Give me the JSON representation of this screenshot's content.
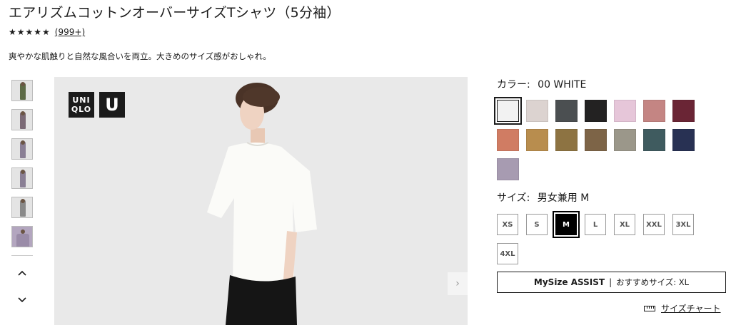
{
  "product": {
    "title": "エアリズムコットンオーバーサイズTシャツ（5分袖）",
    "stars": "★★★★★",
    "review_count": "(999+)",
    "description": "爽やかな肌触りと自然な風合いを両立。大きめのサイズ感がおしゃれ。"
  },
  "gallery": {
    "logo_text": "UNI QLO",
    "logo_u": "U",
    "prev_arrow": "^",
    "next_arrow": "v",
    "image_next": "›"
  },
  "color": {
    "label": "カラー:",
    "selected_name": "00 WHITE",
    "swatches": [
      "#f2f2f2",
      "#dcd3d0",
      "#4b4f51",
      "#232222",
      "#e6c6d9",
      "#c48583",
      "#6a2535",
      "#d07c63",
      "#b88d4e",
      "#8d7342",
      "#7d6447",
      "#9b978a",
      "#3f5b5f",
      "#283153",
      "#a79bb1"
    ]
  },
  "size": {
    "label": "サイズ:",
    "selected_name": "男女兼用 M",
    "options": [
      "XS",
      "S",
      "M",
      "L",
      "XL",
      "XXL",
      "3XL",
      "4XL"
    ]
  },
  "mysize": {
    "title": "MySize ASSIST",
    "separator": "|",
    "recommend": "おすすめサイズ: XL"
  },
  "size_chart": {
    "label": "サイズチャート"
  }
}
